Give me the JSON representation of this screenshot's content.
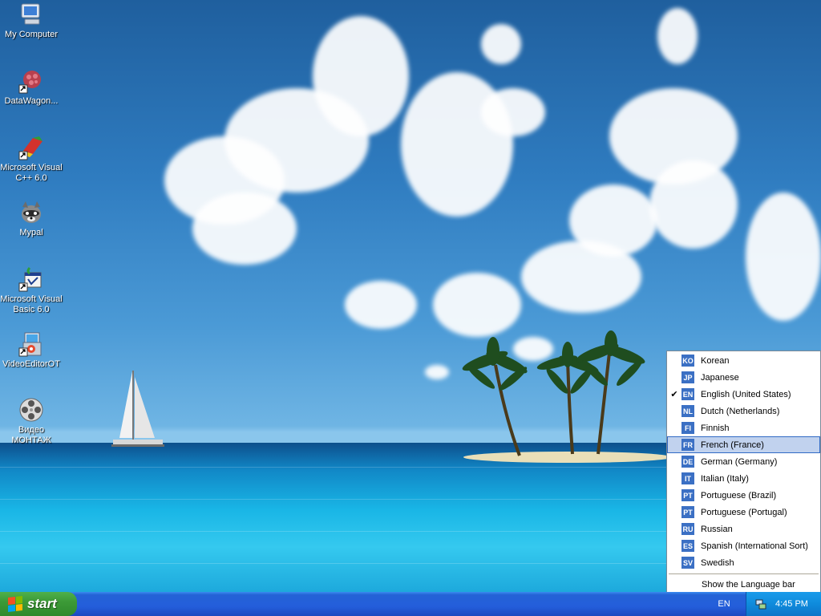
{
  "desktop_icons": [
    {
      "label": "My Computer",
      "icon": "my-computer-icon"
    },
    {
      "label": "DataWagon...",
      "icon": "datawagon-icon"
    },
    {
      "label": "Microsoft Visual\nC++ 6.0",
      "icon": "visual-cpp-icon"
    },
    {
      "label": "Mypal",
      "icon": "mypal-icon"
    },
    {
      "label": "Microsoft Visual\nBasic 6.0",
      "icon": "visual-basic-icon"
    },
    {
      "label": "VideoEditorOT",
      "icon": "video-editor-icon"
    },
    {
      "label": "Видео\nМОНТАЖ",
      "icon": "film-reel-icon"
    }
  ],
  "language_menu": {
    "items": [
      {
        "code": "KO",
        "label": "Korean",
        "checked": false,
        "selected": false
      },
      {
        "code": "JP",
        "label": "Japanese",
        "checked": false,
        "selected": false
      },
      {
        "code": "EN",
        "label": "English (United States)",
        "checked": true,
        "selected": false
      },
      {
        "code": "NL",
        "label": "Dutch (Netherlands)",
        "checked": false,
        "selected": false
      },
      {
        "code": "FI",
        "label": "Finnish",
        "checked": false,
        "selected": false
      },
      {
        "code": "FR",
        "label": "French (France)",
        "checked": false,
        "selected": true
      },
      {
        "code": "DE",
        "label": "German (Germany)",
        "checked": false,
        "selected": false
      },
      {
        "code": "IT",
        "label": "Italian (Italy)",
        "checked": false,
        "selected": false
      },
      {
        "code": "PT",
        "label": "Portuguese (Brazil)",
        "checked": false,
        "selected": false
      },
      {
        "code": "PT",
        "label": "Portuguese (Portugal)",
        "checked": false,
        "selected": false
      },
      {
        "code": "RU",
        "label": "Russian",
        "checked": false,
        "selected": false
      },
      {
        "code": "ES",
        "label": "Spanish (International Sort)",
        "checked": false,
        "selected": false
      },
      {
        "code": "SV",
        "label": "Swedish",
        "checked": false,
        "selected": false
      }
    ],
    "show_language_bar": "Show the Language bar",
    "check_mark": "✔"
  },
  "taskbar": {
    "start_label": "start",
    "language_indicator": "EN",
    "clock": "4:45 PM"
  },
  "colors": {
    "taskbar_blue": "#245edb",
    "start_green": "#3c9a37",
    "menu_highlight": "#c1d2ee",
    "lang_code_blue": "#3b70c4"
  }
}
